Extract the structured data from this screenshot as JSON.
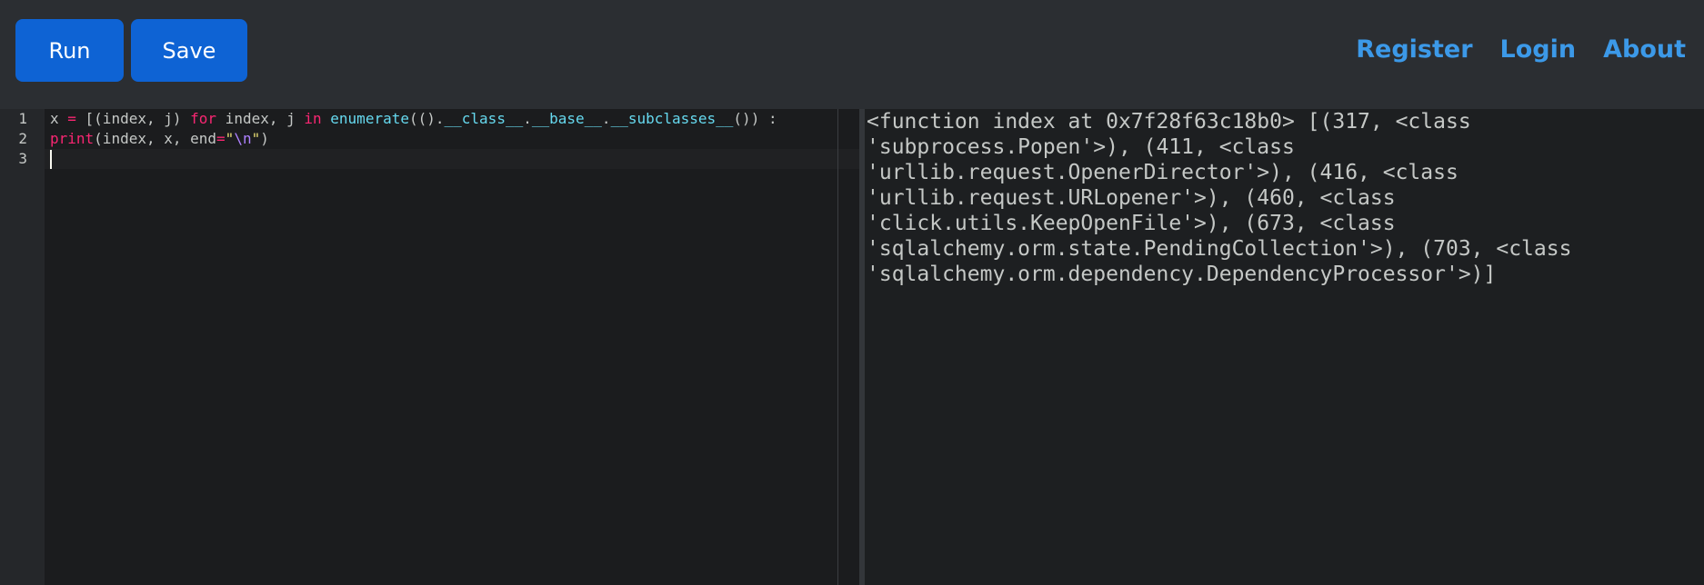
{
  "toolbar": {
    "run_label": "Run",
    "save_label": "Save"
  },
  "nav": {
    "register": "Register",
    "login": "Login",
    "about": "About"
  },
  "editor": {
    "line_numbers": [
      "1",
      "2",
      "3"
    ],
    "line1": {
      "a": "x ",
      "eq": "=",
      "b": " [(index, j) ",
      "for": "for",
      "c": " index, j ",
      "in": "in",
      "d": " ",
      "enumerate": "enumerate",
      "e": "(().",
      "class": "__class__",
      "f": ".",
      "base": "__base__",
      "g": ".",
      "subclasses": "__subclasses__",
      "h": "()) :"
    },
    "line2": {
      "print": "print",
      "a": "(index, x, end",
      "eq": "=",
      "q1": "\"",
      "esc": "\\n",
      "q2": "\"",
      "b": ")"
    }
  },
  "output": {
    "lines": [
      "<function index at 0x7f28f63c18b0> [(317, <class",
      "'subprocess.Popen'>), (411, <class",
      "'urllib.request.OpenerDirector'>), (416, <class",
      "'urllib.request.URLopener'>), (460, <class",
      "'click.utils.KeepOpenFile'>), (673, <class",
      "'sqlalchemy.orm.state.PendingCollection'>), (703, <class",
      "'sqlalchemy.orm.dependency.DependencyProcessor'>)]"
    ]
  }
}
